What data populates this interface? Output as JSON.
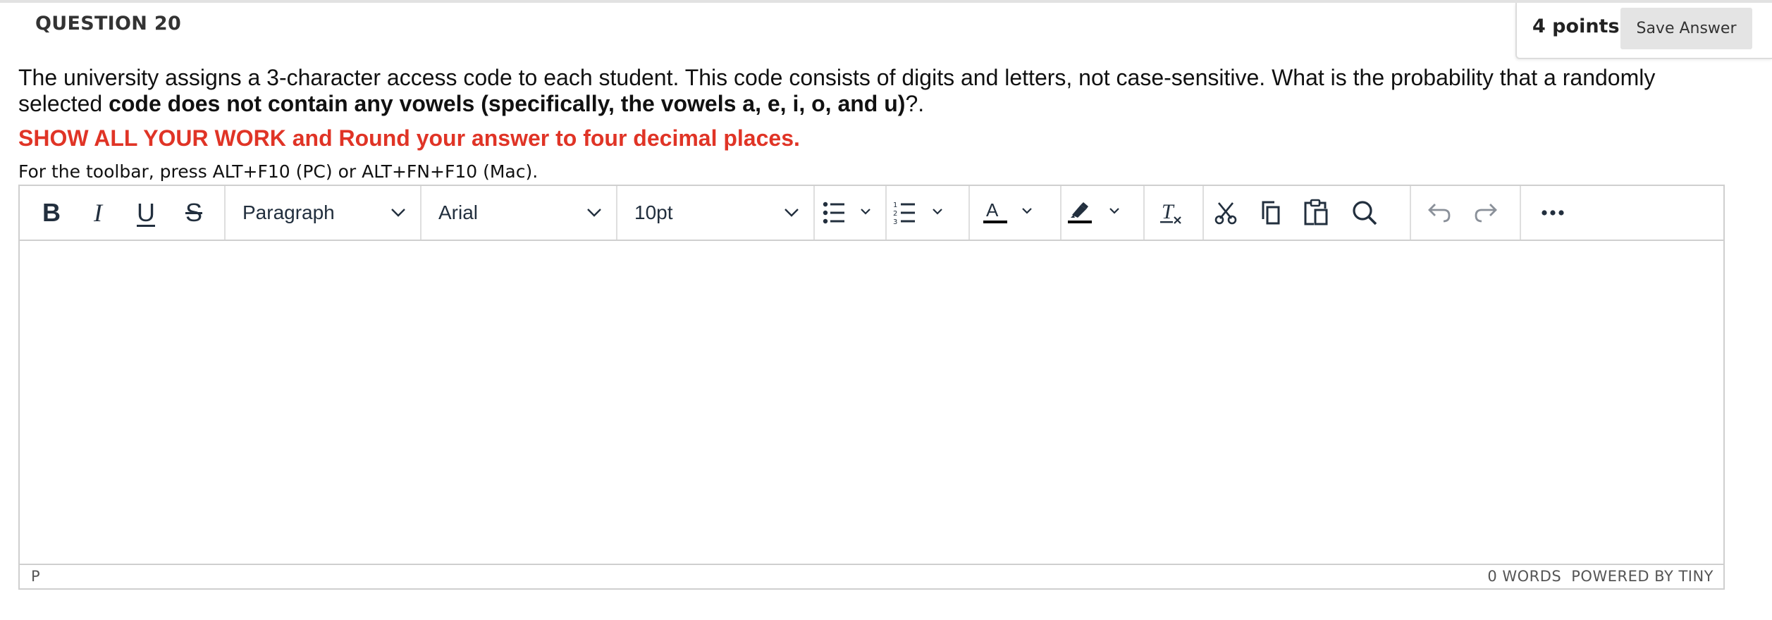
{
  "header": {
    "question_title": "QUESTION 20",
    "points": "4 points",
    "save_label": "Save Answer"
  },
  "question": {
    "text_part1": "The university assigns a 3-character access code to each student. This code consists of digits and letters, not case-sensitive. What is the probability that a randomly selected ",
    "text_bold": "code does not contain any vowels (specifically, the vowels a, e, i, o, and u)",
    "text_part2": "?.",
    "instruction": "SHOW ALL YOUR WORK and Round your answer to four decimal places.",
    "toolbar_hint": "For the toolbar, press ALT+F10 (PC) or ALT+FN+F10 (Mac)."
  },
  "editor": {
    "toolbar": {
      "bold": "B",
      "italic": "I",
      "underline": "U",
      "strike": "S",
      "block_format": "Paragraph",
      "font_family": "Arial",
      "font_size": "10pt",
      "icons": [
        "bold-icon",
        "italic-icon",
        "underline-icon",
        "strikethrough-icon",
        "chevron-down-icon",
        "bullet-list-icon",
        "numbered-list-icon",
        "text-color-icon",
        "highlight-icon",
        "clear-formatting-icon",
        "cut-icon",
        "copy-icon",
        "paste-icon",
        "search-icon",
        "undo-icon",
        "redo-icon",
        "more-icon"
      ]
    },
    "content": "",
    "statusbar": {
      "path": "P",
      "word_count": "0 WORDS",
      "powered_by": "POWERED BY TINY"
    }
  },
  "colors": {
    "instruction_red": "#e03426",
    "text_color_swatch": "#000000",
    "highlight_swatch": "#000000",
    "toolbar_icon": "#222f3e"
  }
}
